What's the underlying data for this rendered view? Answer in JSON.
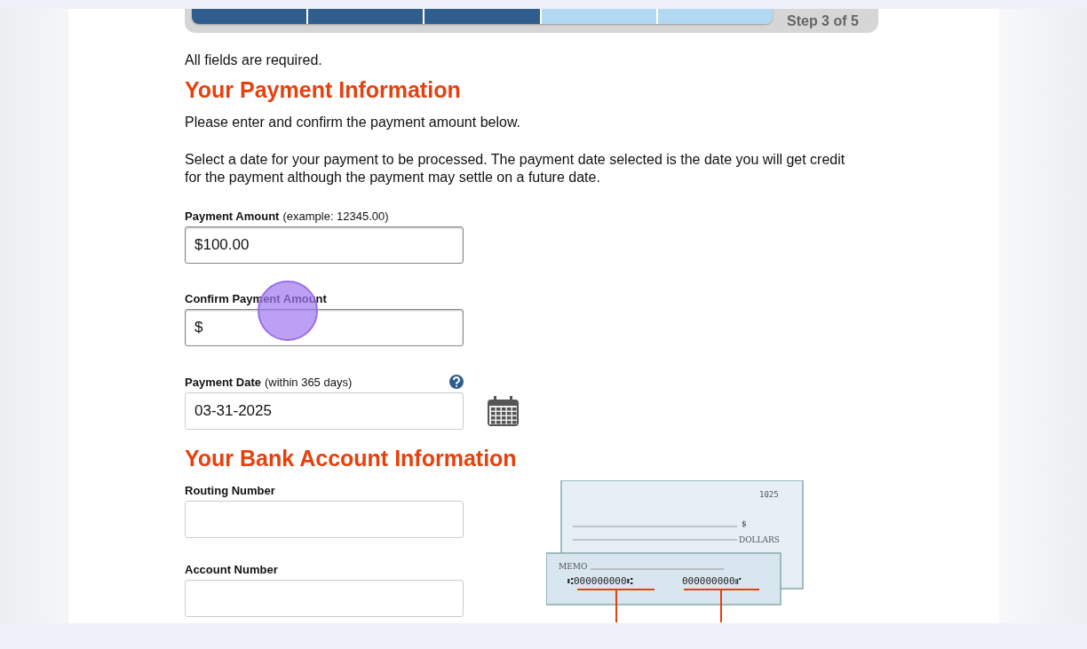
{
  "progress": {
    "steps": [
      {
        "completed": true
      },
      {
        "completed": true
      },
      {
        "completed": true
      },
      {
        "completed": false
      },
      {
        "completed": false
      }
    ],
    "label": "Step 3 of 5"
  },
  "required_note": "All fields are required.",
  "payment_section": {
    "heading": "Your Payment Information",
    "intro": "Please enter and confirm the payment amount below.",
    "details": "Select a date for your payment to be processed. The payment date selected is the date you will get credit for the payment although the payment may settle on a future date.",
    "fields": [
      {
        "kind": "amount",
        "label": "Payment Amount",
        "hint": "(example: 12345.00)",
        "value": "$100.00"
      },
      {
        "kind": "confirm",
        "label": "Confirm Payment Amount",
        "value": "$",
        "focused": true
      },
      {
        "kind": "date",
        "label": "Payment Date",
        "hint": "(within 365 days)",
        "value": "03-31-2025"
      }
    ]
  },
  "bank_section": {
    "heading": "Your Bank Account Information",
    "fields": [
      {
        "label": "Routing Number"
      },
      {
        "label": "Account Number"
      }
    ],
    "check": {
      "number": "1025",
      "dollar_sign": "$",
      "dollars": "DOLLARS",
      "memo": "MEMO",
      "routing": "⑆000000000⑆",
      "account": "000000000⑈"
    }
  }
}
